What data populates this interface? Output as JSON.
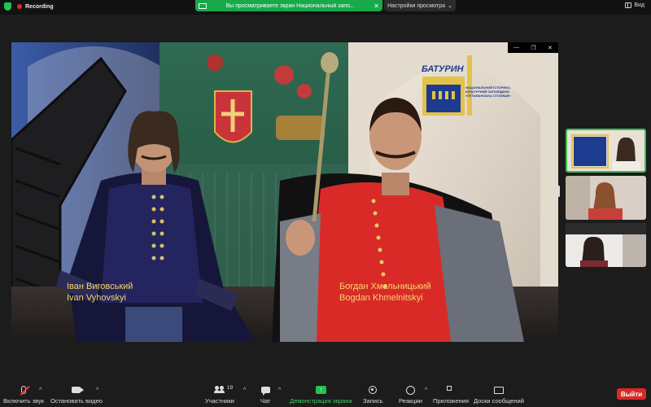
{
  "topbar": {
    "recording_label": "Recording",
    "share_banner_text": "Вы просматриваете экран Национальный запо...",
    "view_settings_label": "Настройки просмотра",
    "view_label": "Вид"
  },
  "shared_screen": {
    "captions": [
      {
        "ua": "Іван Виговський",
        "en": "Ivan Vyhovskyi"
      },
      {
        "ua": "Богдан Хмельницький",
        "en": "Bogdan Khmelnitskyi"
      }
    ],
    "logo_name": "БАТУРИН",
    "logo_subtitle": "НАЦІОНАЛЬНИЙ ІСТОРИКО-КУЛЬТУРНИЙ ЗАПОВІДНИК «ГЕТЬМАНСЬКА СТОЛИЦЯ»",
    "window_controls": [
      "—",
      "❐",
      "✕"
    ]
  },
  "gallery": {
    "tiles": [
      {
        "logo": "БАТУРИН"
      },
      {},
      {}
    ]
  },
  "toolbar": {
    "mute": "Включить звук",
    "video": "Остановить видео",
    "participants": "Участники",
    "participants_count": "19",
    "chat": "Чат",
    "share": "Демонстрация экрана",
    "record": "Запись",
    "reactions": "Реакции",
    "apps": "Приложения",
    "whiteboards": "Доски сообщений",
    "end": "Выйти"
  },
  "colors": {
    "accent_green": "#27c24c",
    "end_red": "#d92828",
    "caption_yellow": "#f5d76e"
  }
}
